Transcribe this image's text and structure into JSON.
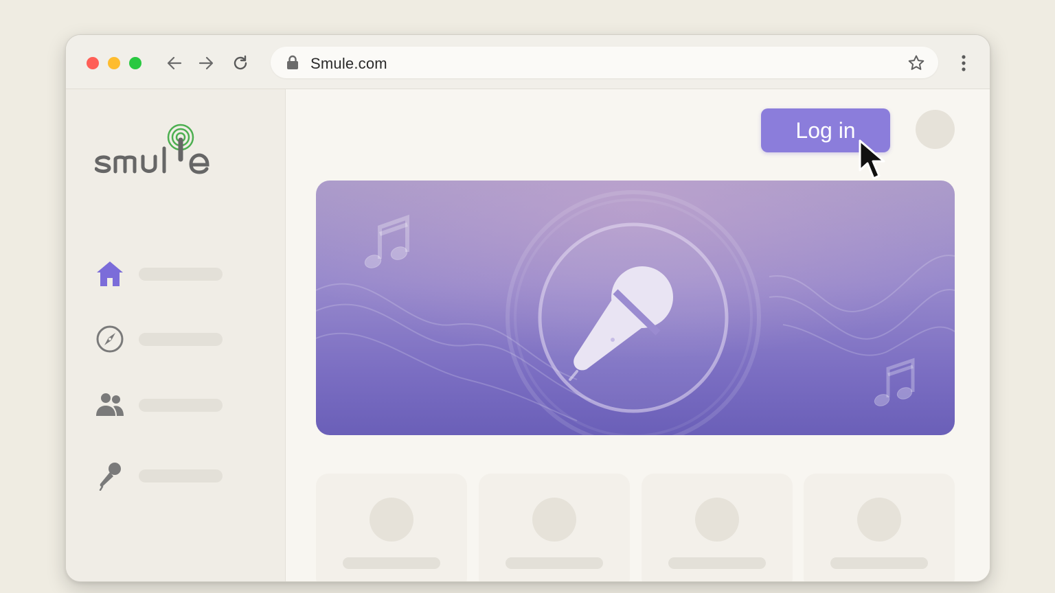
{
  "browser": {
    "url": "Smule.com",
    "buttons": [
      "back-icon",
      "forward-icon",
      "reload-icon",
      "star-icon",
      "more-icon"
    ]
  },
  "sidebar": {
    "logo_text": "smule",
    "items": [
      {
        "icon": "home-icon",
        "active": true
      },
      {
        "icon": "compass-icon",
        "active": false
      },
      {
        "icon": "people-icon",
        "active": false
      },
      {
        "icon": "microphone-icon",
        "active": false
      }
    ]
  },
  "header": {
    "login_label": "Log in"
  },
  "hero": {
    "icon": "microphone-icon"
  },
  "colors": {
    "accent": "#8b7ddb",
    "hero_top": "#a99ac9",
    "hero_bottom": "#6a5fb8",
    "home_active": "#7b6cd9",
    "logo_green": "#4caf50",
    "logo_gray": "#666666"
  },
  "cards": [
    {
      "placeholder": true
    },
    {
      "placeholder": true
    },
    {
      "placeholder": true
    },
    {
      "placeholder": true
    }
  ]
}
